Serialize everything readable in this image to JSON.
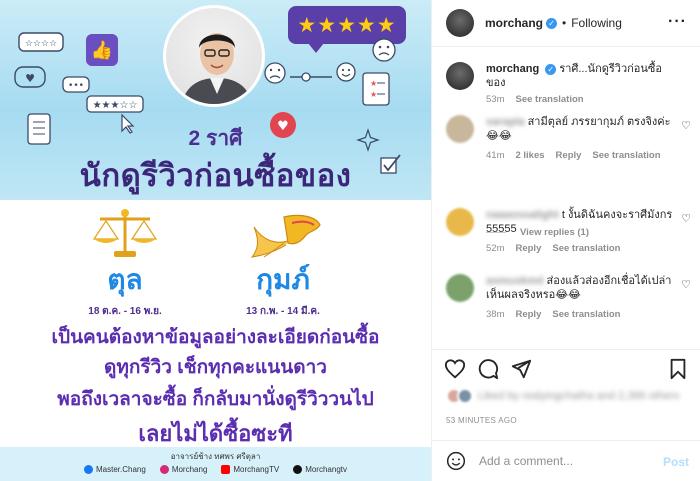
{
  "post_image": {
    "rating_stars": "★★★★★",
    "subtitle": "2 ราศี",
    "headline": "นักดูรีวิวก่อนซื้อของ",
    "signs": [
      {
        "name": "ตุล",
        "dates": "18 ต.ค. - 16 พ.ย."
      },
      {
        "name": "กุมภ์",
        "dates": "13 ก.พ. - 14 มี.ค."
      }
    ],
    "description": [
      "เป็นคนต้องหาข้อมูลอย่างละเอียดก่อนซื้อ",
      "ดูทุกรีวิว เช็กทุกคะแนนดาว",
      "พอถึงเวลาจะซื้อ ก็กลับมานั่งดูรีวิววนไป",
      "เลยไม่ได้ซื้อซะที"
    ],
    "credit": "อาจารย์ช้าง ทศพร ศรีตุลา",
    "socials": [
      {
        "label": "Master.Chang",
        "color": "#1877f2"
      },
      {
        "label": "Morchang",
        "color": "#d62976"
      },
      {
        "label": "MorchangTV",
        "color": "#ff0000"
      },
      {
        "label": "Morchangtv",
        "color": "#111111"
      }
    ]
  },
  "header": {
    "username": "morchang",
    "follow_status": "Following",
    "more_icon": "ellipsis-icon"
  },
  "caption": {
    "username": "morchang",
    "text": "ราศี...นักดูรีวิวก่อนซื้อของ",
    "time": "53m",
    "see_translation": "See translation"
  },
  "comments": [
    {
      "username": "sarapla",
      "text": "สามีตุลย์ ภรรยากุมภ์ ตรงจิงค่ะ 😂😂",
      "time": "41m",
      "likes": "2 likes",
      "reply": "Reply",
      "see_translation": "See translation",
      "avatar_color": "#c9b79c"
    },
    {
      "username": "naaasssalight",
      "text": "t งั้นดิฉันคงจะราศีมังกร 55555",
      "time": "52m",
      "likes": "",
      "reply": "Reply",
      "see_translation": "See translation",
      "avatar_color": "#e8b94a"
    },
    {
      "username": "asmuskmd",
      "text": "ส่องแล้วส่องอีกเชื่อได้เปล่า เห็นผลจริงหรอ😂😂",
      "time": "38m",
      "likes": "",
      "reply": "Reply",
      "see_translation": "See translation",
      "avatar_color": "#7aa26a"
    }
  ],
  "view_replies": "View replies (1)",
  "likes_text": "Liked by realyingchatha and 2,386 others",
  "timestamp": "53 MINUTES AGO",
  "comment_box": {
    "placeholder": "Add a comment...",
    "post_label": "Post"
  }
}
